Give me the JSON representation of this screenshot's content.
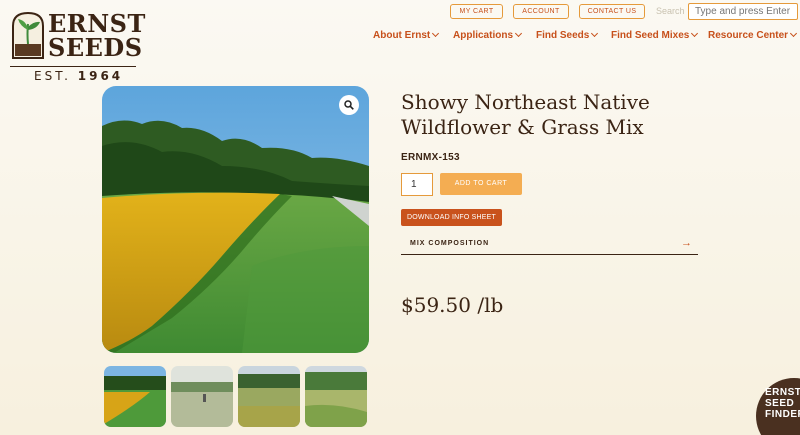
{
  "logo": {
    "line1": "ERNST",
    "line2": "SEEDS",
    "est_prefix": "EST.",
    "est_year": "1964"
  },
  "utility": {
    "cart": "MY CART",
    "account": "ACCOUNT",
    "contact": "CONTACT US",
    "search_label": "Search",
    "search_placeholder": "Type and press Enter"
  },
  "nav": [
    "About Ernst",
    "Applications",
    "Find Seeds",
    "Find Seed Mixes",
    "Resource Center"
  ],
  "product": {
    "title_line1": "Showy Northeast Native",
    "title_line2": "Wildflower & Grass Mix",
    "sku": "ERNMX-153",
    "quantity": "1",
    "add_to_cart": "ADD TO CART",
    "download": "DOWNLOAD INFO SHEET",
    "mix_composition": "MIX COMPOSITION",
    "price": "$59.50 /lb"
  },
  "seed_finder": {
    "line1": "ERNST",
    "line2": "SEED",
    "line3": "FINDER"
  },
  "colors": {
    "accent": "#c7501b",
    "orange": "#f4ad52",
    "brown": "#3b2414",
    "button_border": "#e59a3b"
  },
  "icons": {
    "zoom": "magnifier-icon",
    "arrow": "arrow-right-icon"
  }
}
